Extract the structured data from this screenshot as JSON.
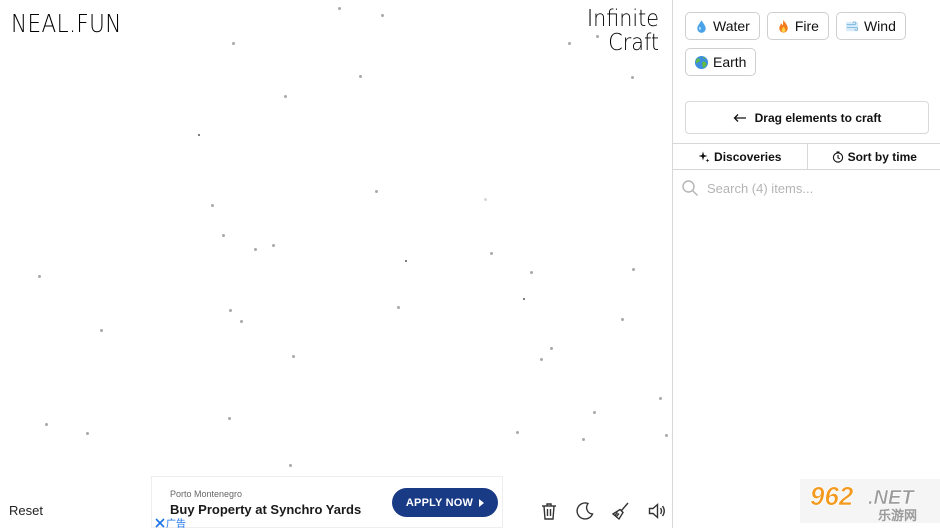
{
  "brand": {
    "neal": "NEAL.FUN",
    "title_line1": "Infinite",
    "title_line2": "Craft"
  },
  "canvas": {
    "reset_label": "Reset"
  },
  "ad": {
    "source": "Porto Montenegro",
    "headline": "Buy Property at Synchro Yards",
    "cta": "APPLY NOW",
    "close_label": "广告",
    "cta_color": "#193a85"
  },
  "tools": [
    {
      "name": "trash-icon"
    },
    {
      "name": "moon-icon"
    },
    {
      "name": "broom-icon"
    },
    {
      "name": "sound-icon"
    }
  ],
  "elements": [
    {
      "label": "Water",
      "icon": "droplet-icon"
    },
    {
      "label": "Fire",
      "icon": "fire-icon"
    },
    {
      "label": "Wind",
      "icon": "wind-icon"
    },
    {
      "label": "Earth",
      "icon": "globe-icon"
    }
  ],
  "sidebar": {
    "drag_hint": "Drag elements to craft",
    "tabs": [
      {
        "label": "Discoveries",
        "icon": "sparkle-icon"
      },
      {
        "label": "Sort by time",
        "icon": "clock-icon"
      }
    ],
    "search": {
      "placeholder": "Search (4) items..."
    }
  },
  "watermark": {
    "text1": "962",
    "text2": ".NET",
    "sub": "乐游网"
  }
}
